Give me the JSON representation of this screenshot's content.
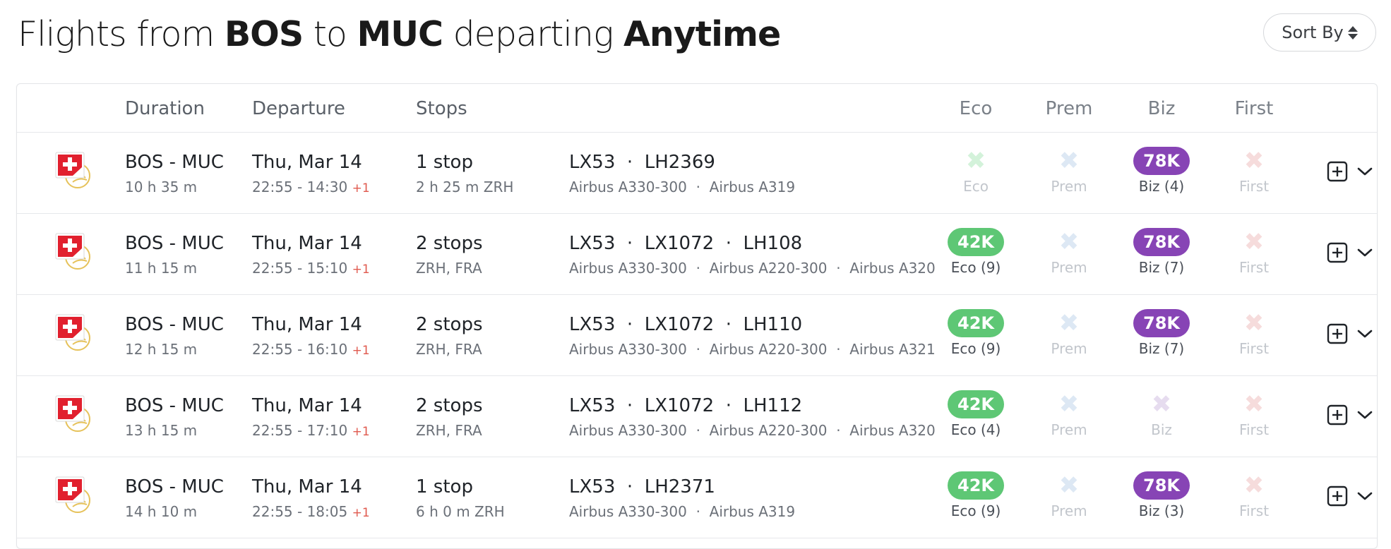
{
  "title": {
    "prefix": "Flights from",
    "origin": "BOS",
    "to": "to",
    "destination": "MUC",
    "departing": "departing",
    "when": "Anytime"
  },
  "sort_button": {
    "label": "Sort By",
    "icon": "sort-updown-icon"
  },
  "columns": {
    "duration": "Duration",
    "departure": "Departure",
    "stops": "Stops",
    "eco": "Eco",
    "prem": "Prem",
    "biz": "Biz",
    "first": "First"
  },
  "colors": {
    "eco": "#5ec775",
    "biz": "#8744b5",
    "eco_x": "#d3f2da",
    "prem_x": "#dde8f4",
    "biz_x": "#e6dcef",
    "first_x": "#f6dcdc"
  },
  "rows": [
    {
      "airline_icon": "swiss-airline-icon",
      "route": "BOS - MUC",
      "duration": "10 h 35 m",
      "date": "Thu, Mar 14",
      "time": "22:55 - 14:30",
      "plus_day": "+1",
      "stops": "1 stop",
      "stop_detail": "2 h 25 m  ZRH",
      "flights": "LX53  ·  LH2369",
      "aircraft": "Airbus A330-300  ·  Airbus A319",
      "eco": {
        "available": false,
        "label": "Eco"
      },
      "prem": {
        "available": false,
        "label": "Prem"
      },
      "biz": {
        "available": true,
        "price": "78K",
        "label": "Biz (4)"
      },
      "first": {
        "available": false,
        "label": "First"
      }
    },
    {
      "airline_icon": "swiss-airline-icon",
      "route": "BOS - MUC",
      "duration": "11 h 15 m",
      "date": "Thu, Mar 14",
      "time": "22:55 - 15:10",
      "plus_day": "+1",
      "stops": "2 stops",
      "stop_detail": "ZRH, FRA",
      "flights": "LX53  ·  LX1072  ·  LH108",
      "aircraft": "Airbus A330-300  ·  Airbus A220-300  ·  Airbus A320",
      "eco": {
        "available": true,
        "price": "42K",
        "label": "Eco (9)"
      },
      "prem": {
        "available": false,
        "label": "Prem"
      },
      "biz": {
        "available": true,
        "price": "78K",
        "label": "Biz (7)"
      },
      "first": {
        "available": false,
        "label": "First"
      }
    },
    {
      "airline_icon": "swiss-airline-icon",
      "route": "BOS - MUC",
      "duration": "12 h 15 m",
      "date": "Thu, Mar 14",
      "time": "22:55 - 16:10",
      "plus_day": "+1",
      "stops": "2 stops",
      "stop_detail": "ZRH, FRA",
      "flights": "LX53  ·  LX1072  ·  LH110",
      "aircraft": "Airbus A330-300  ·  Airbus A220-300  ·  Airbus A321",
      "eco": {
        "available": true,
        "price": "42K",
        "label": "Eco (9)"
      },
      "prem": {
        "available": false,
        "label": "Prem"
      },
      "biz": {
        "available": true,
        "price": "78K",
        "label": "Biz (7)"
      },
      "first": {
        "available": false,
        "label": "First"
      }
    },
    {
      "airline_icon": "swiss-airline-icon",
      "route": "BOS - MUC",
      "duration": "13 h 15 m",
      "date": "Thu, Mar 14",
      "time": "22:55 - 17:10",
      "plus_day": "+1",
      "stops": "2 stops",
      "stop_detail": "ZRH, FRA",
      "flights": "LX53  ·  LX1072  ·  LH112",
      "aircraft": "Airbus A330-300  ·  Airbus A220-300  ·  Airbus A320",
      "eco": {
        "available": true,
        "price": "42K",
        "label": "Eco (4)"
      },
      "prem": {
        "available": false,
        "label": "Prem"
      },
      "biz": {
        "available": false,
        "label": "Biz"
      },
      "first": {
        "available": false,
        "label": "First"
      }
    },
    {
      "airline_icon": "swiss-airline-icon",
      "route": "BOS - MUC",
      "duration": "14 h 10 m",
      "date": "Thu, Mar 14",
      "time": "22:55 - 18:05",
      "plus_day": "+1",
      "stops": "1 stop",
      "stop_detail": "6 h 0 m  ZRH",
      "flights": "LX53  ·  LH2371",
      "aircraft": "Airbus A330-300  ·  Airbus A319",
      "eco": {
        "available": true,
        "price": "42K",
        "label": "Eco (9)"
      },
      "prem": {
        "available": false,
        "label": "Prem"
      },
      "biz": {
        "available": true,
        "price": "78K",
        "label": "Biz (3)"
      },
      "first": {
        "available": false,
        "label": "First"
      }
    }
  ]
}
